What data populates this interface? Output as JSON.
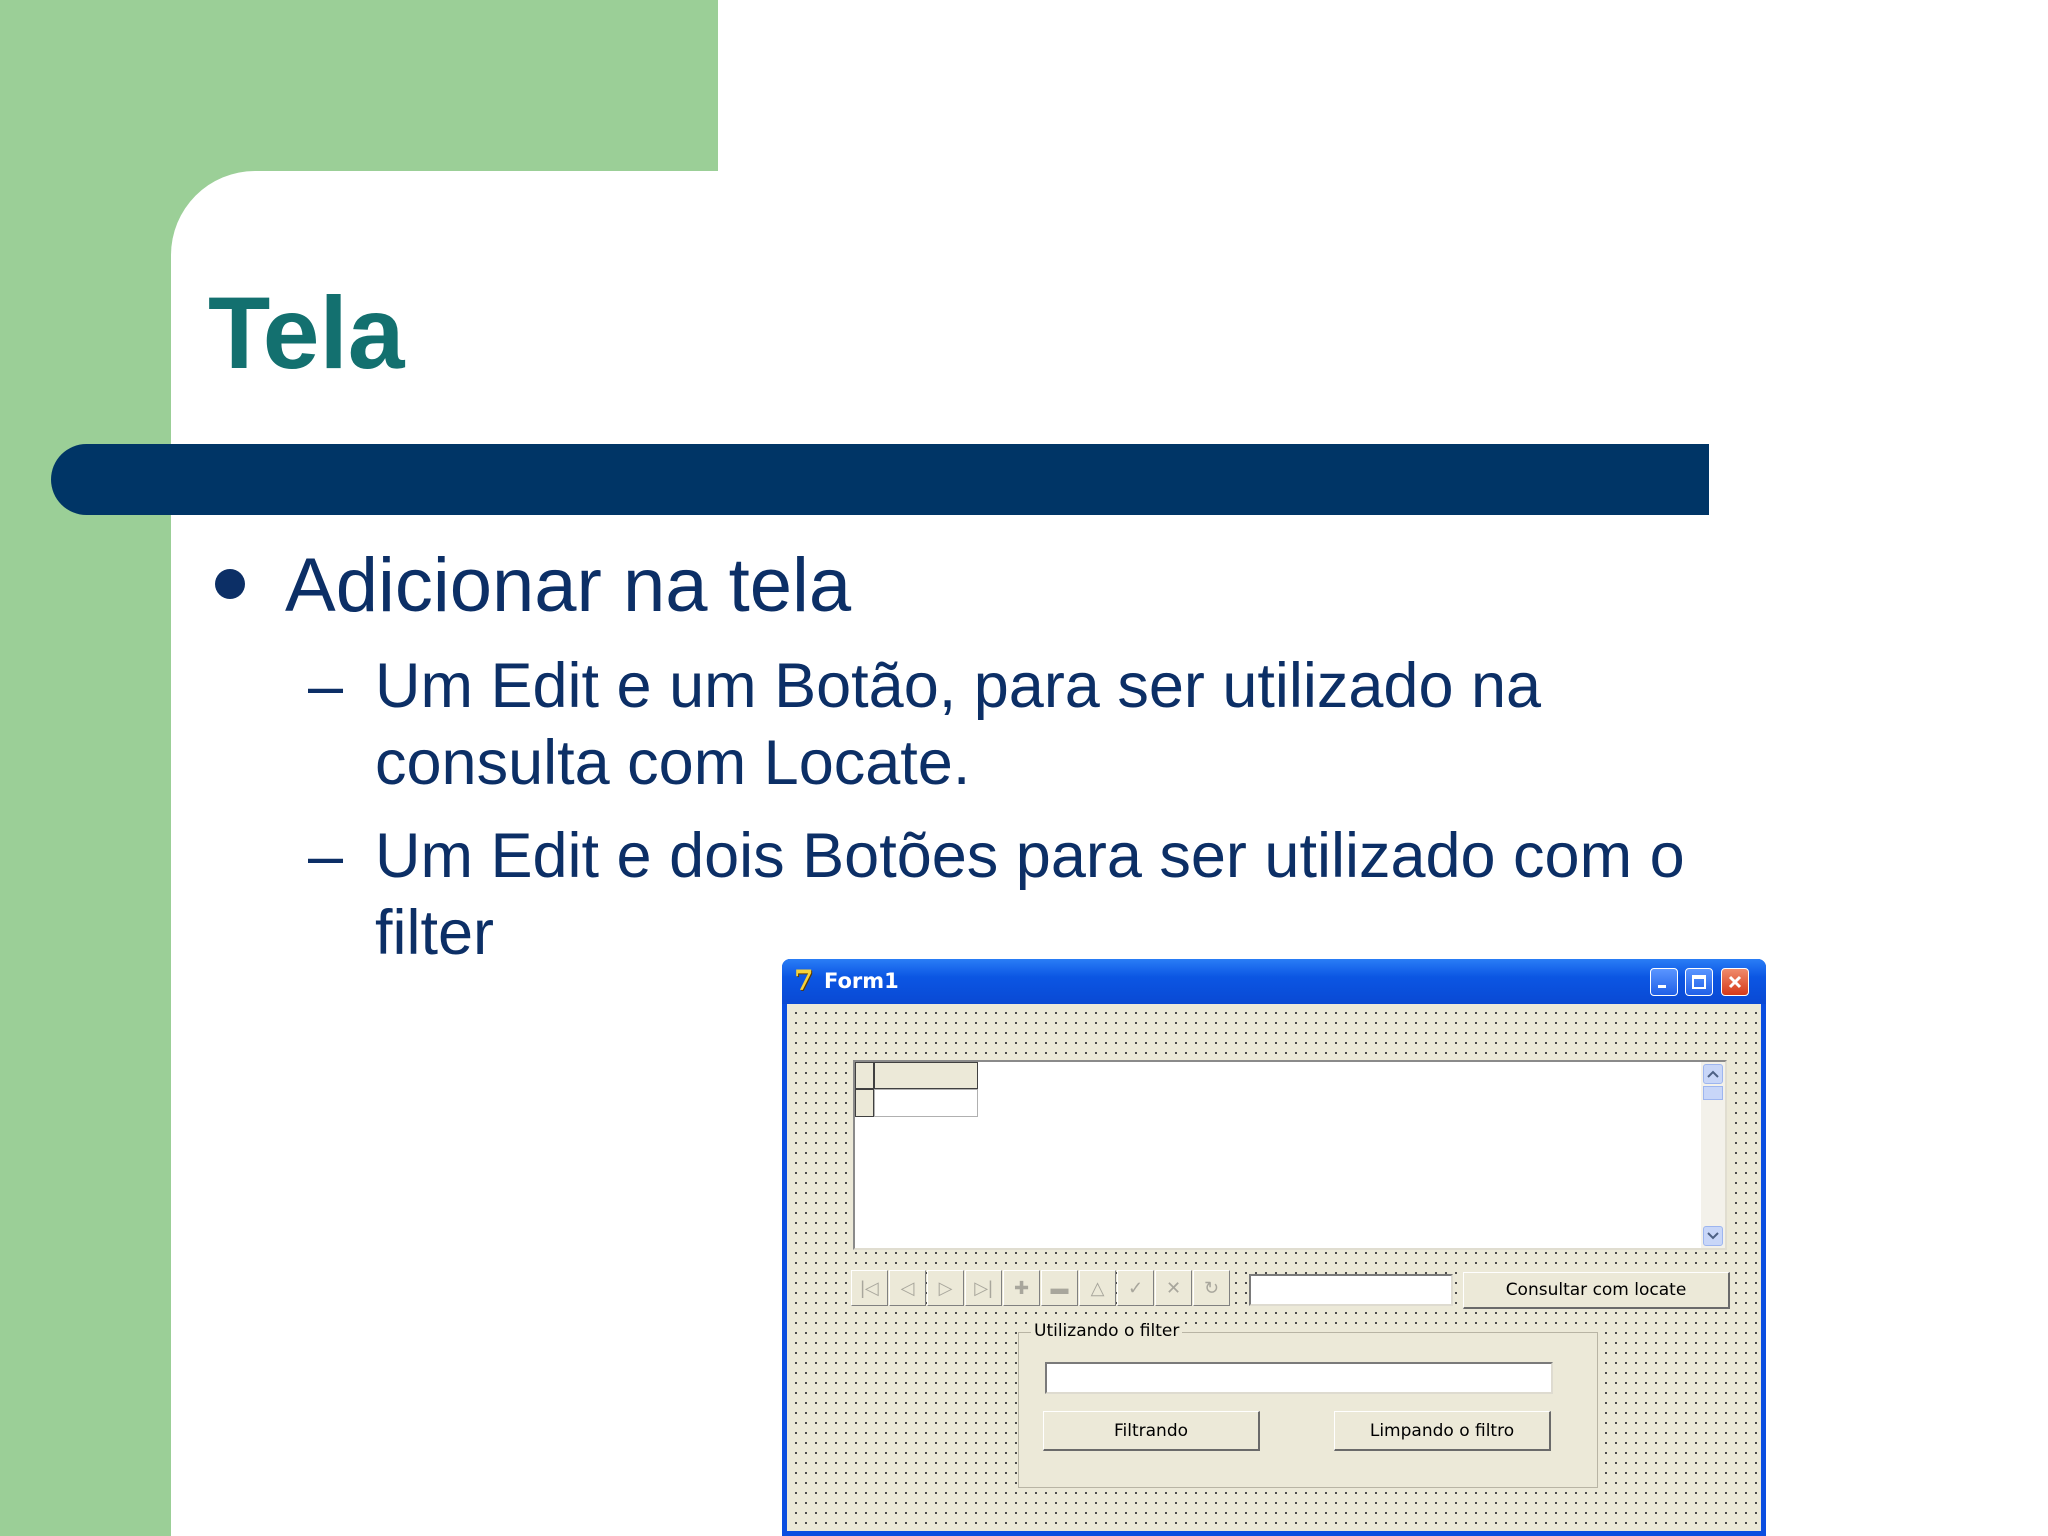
{
  "slide": {
    "title": "Tela",
    "bullet": "Adicionar na tela",
    "sub_bullets": [
      {
        "dash": "–",
        "text_line1": "Um Edit e um Botão, para ser utilizado na",
        "text_line2": "consulta com Locate."
      },
      {
        "dash": "–",
        "text_line1": "Um Edit e dois Botões para ser utilizado com o",
        "text_line2": "filter"
      }
    ]
  },
  "window": {
    "title": "Form1",
    "icon": "delphi-icon",
    "locate_button_label": "Consultar com locate",
    "locate_edit_value": "",
    "filter_group": {
      "caption": "Utilizando o filter",
      "edit_value": "",
      "filter_button_label": "Filtrando",
      "clear_button_label": "Limpando o filtro"
    },
    "navigator_buttons": [
      "first-icon",
      "prior-icon",
      "next-icon",
      "last-icon",
      "insert-icon",
      "delete-icon",
      "edit-icon",
      "post-icon",
      "cancel-icon",
      "refresh-icon"
    ]
  },
  "colors": {
    "green": "#9bcf97",
    "title_teal": "#13706f",
    "navy": "#003566",
    "text_blue": "#0c2f66",
    "xp_blue": "#0b56e3",
    "form_face": "#ece9d8"
  }
}
